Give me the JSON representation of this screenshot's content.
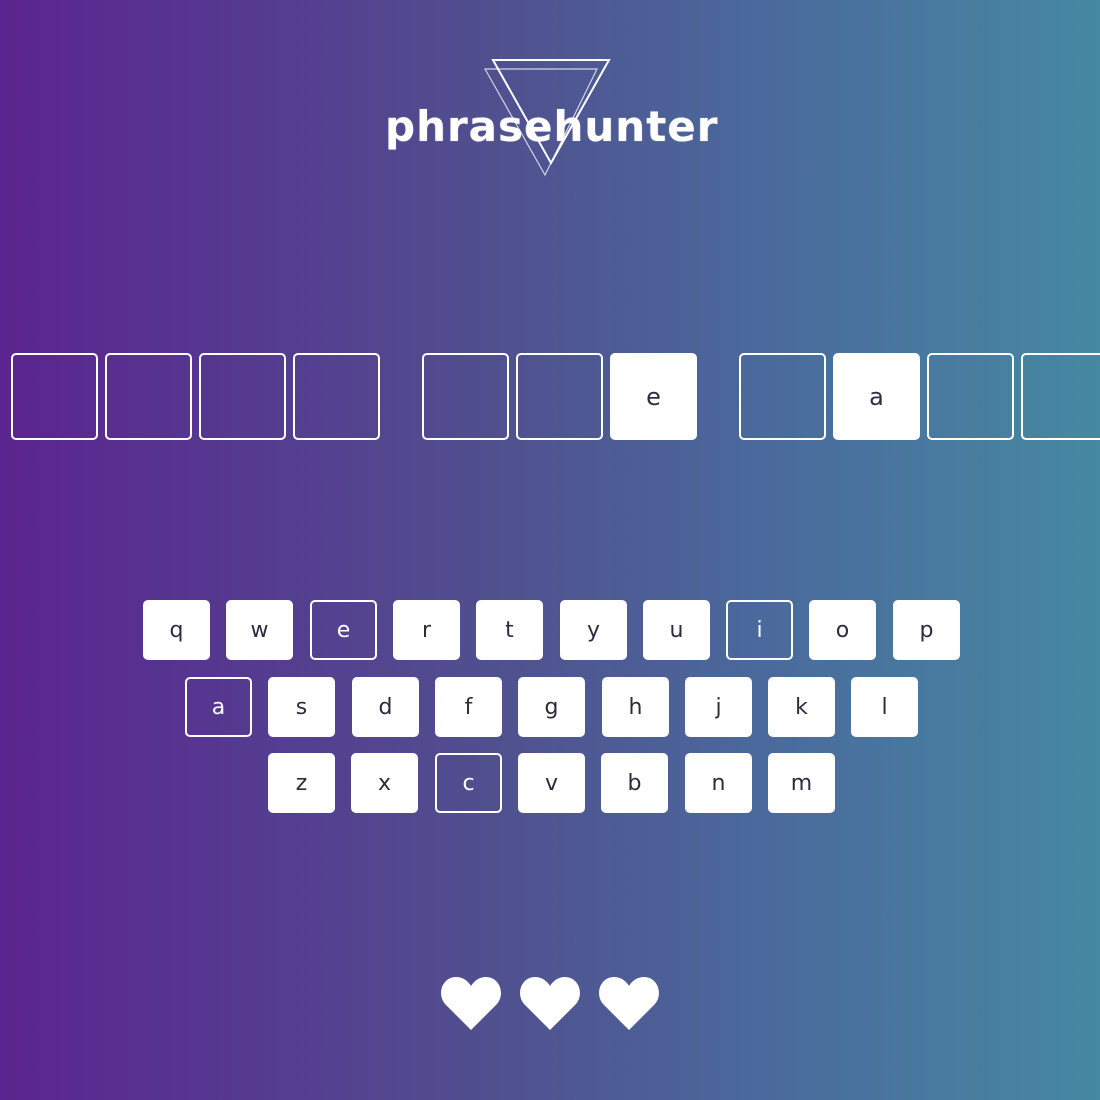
{
  "title": "phrasehunter",
  "phrase": {
    "words": [
      [
        {
          "letter": "",
          "shown": false
        },
        {
          "letter": "",
          "shown": false
        },
        {
          "letter": "",
          "shown": false
        },
        {
          "letter": "",
          "shown": false
        }
      ],
      [
        {
          "letter": "",
          "shown": false
        },
        {
          "letter": "",
          "shown": false
        },
        {
          "letter": "e",
          "shown": true
        }
      ],
      [
        {
          "letter": "",
          "shown": false
        },
        {
          "letter": "a",
          "shown": true
        },
        {
          "letter": "",
          "shown": false
        },
        {
          "letter": "",
          "shown": false
        }
      ]
    ]
  },
  "keyboard": {
    "rows": [
      [
        {
          "letter": "q",
          "used": false
        },
        {
          "letter": "w",
          "used": false
        },
        {
          "letter": "e",
          "used": true
        },
        {
          "letter": "r",
          "used": false
        },
        {
          "letter": "t",
          "used": false
        },
        {
          "letter": "y",
          "used": false
        },
        {
          "letter": "u",
          "used": false
        },
        {
          "letter": "i",
          "used": true
        },
        {
          "letter": "o",
          "used": false
        },
        {
          "letter": "p",
          "used": false
        }
      ],
      [
        {
          "letter": "a",
          "used": true
        },
        {
          "letter": "s",
          "used": false
        },
        {
          "letter": "d",
          "used": false
        },
        {
          "letter": "f",
          "used": false
        },
        {
          "letter": "g",
          "used": false
        },
        {
          "letter": "h",
          "used": false
        },
        {
          "letter": "j",
          "used": false
        },
        {
          "letter": "k",
          "used": false
        },
        {
          "letter": "l",
          "used": false
        }
      ],
      [
        {
          "letter": "z",
          "used": false
        },
        {
          "letter": "x",
          "used": false
        },
        {
          "letter": "c",
          "used": true
        },
        {
          "letter": "v",
          "used": false
        },
        {
          "letter": "b",
          "used": false
        },
        {
          "letter": "n",
          "used": false
        },
        {
          "letter": "m",
          "used": false
        }
      ]
    ]
  },
  "lives": {
    "remaining": 3,
    "icon": "heart-icon"
  },
  "colors": {
    "gradient_start": "#5b2490",
    "gradient_end": "#4689a2",
    "tile": "#ffffff",
    "key_text": "#2c2c3e"
  }
}
